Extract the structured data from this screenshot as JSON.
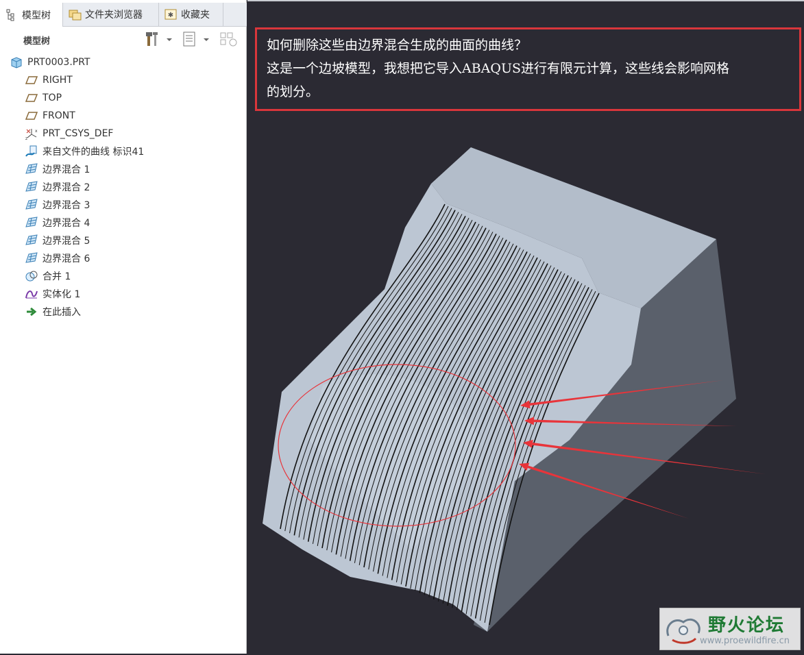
{
  "tabs": [
    {
      "label": "模型树",
      "icon": "model-tree-icon",
      "active": true
    },
    {
      "label": "文件夹浏览器",
      "icon": "folder-browser-icon",
      "active": false
    },
    {
      "label": "收藏夹",
      "icon": "favorites-icon",
      "active": false
    }
  ],
  "toolbar": {
    "title": "模型树",
    "icons": [
      "settings-tools-icon",
      "dropdown-icon",
      "tree-columns-icon",
      "dropdown-icon",
      "show-icon"
    ]
  },
  "tree": {
    "root": {
      "label": "PRT0003.PRT",
      "icon": "part-icon"
    },
    "items": [
      {
        "label": "RIGHT",
        "icon": "datum-plane-icon"
      },
      {
        "label": "TOP",
        "icon": "datum-plane-icon"
      },
      {
        "label": "FRONT",
        "icon": "datum-plane-icon"
      },
      {
        "label": "PRT_CSYS_DEF",
        "icon": "coordinate-system-icon"
      },
      {
        "label": "来自文件的曲线 标识41",
        "icon": "curve-from-file-icon"
      },
      {
        "label": "边界混合 1",
        "icon": "boundary-blend-icon"
      },
      {
        "label": "边界混合 2",
        "icon": "boundary-blend-icon"
      },
      {
        "label": "边界混合 3",
        "icon": "boundary-blend-icon"
      },
      {
        "label": "边界混合 4",
        "icon": "boundary-blend-icon"
      },
      {
        "label": "边界混合 5",
        "icon": "boundary-blend-icon"
      },
      {
        "label": "边界混合 6",
        "icon": "boundary-blend-icon"
      },
      {
        "label": "合并 1",
        "icon": "merge-icon"
      },
      {
        "label": "实体化 1",
        "icon": "solidify-icon"
      },
      {
        "label": "在此插入",
        "icon": "insert-here-arrow-icon"
      }
    ]
  },
  "question": {
    "line1": "如何删除这些由边界混合生成的曲面的曲线？",
    "line2": "这是一个边坡模型，我想把它导入ABAQUS进行有限元计算，这些线会影响网格",
    "line3": "的划分。"
  },
  "watermark": {
    "title": "野火论坛",
    "url": "www.proewildfire.cn"
  },
  "colors": {
    "annotation_red": "#e8343a",
    "viewport_bg": "#2b2a33",
    "surface_top": "#bcc6d3",
    "surface_side": "#5a606b",
    "wm_green": "#1f7a34"
  }
}
